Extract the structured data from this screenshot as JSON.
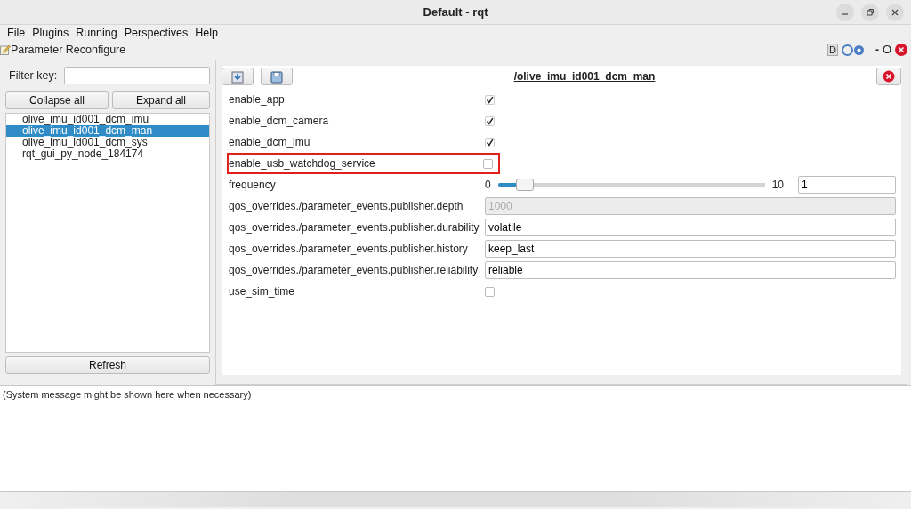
{
  "window": {
    "title": "Default - rqt"
  },
  "menu": [
    {
      "label": "File"
    },
    {
      "label": "Plugins"
    },
    {
      "label": "Running"
    },
    {
      "label": "Perspectives"
    },
    {
      "label": "Help"
    }
  ],
  "dock": {
    "title": "Parameter Reconfigure",
    "tools": [
      "D",
      "-",
      "O"
    ]
  },
  "filter": {
    "label": "Filter key:"
  },
  "tree_buttons": [
    "Collapse all",
    "Expand all"
  ],
  "nodes": [
    {
      "label": "olive_imu_id001_dcm_imu",
      "selected": false
    },
    {
      "label": "olive_imu_id001_dcm_man",
      "selected": true
    },
    {
      "label": "olive_imu_id001_dcm_sys",
      "selected": false
    },
    {
      "label": "rqt_gui_py_node_184174",
      "selected": false
    }
  ],
  "refresh_button": "Refresh",
  "node_title": "/olive_imu_id001_dcm_man",
  "params": [
    {
      "name": "enable_app",
      "kind": "checkbox",
      "checked": true,
      "highlighted": false
    },
    {
      "name": "enable_dcm_camera",
      "kind": "checkbox",
      "checked": true,
      "highlighted": false
    },
    {
      "name": "enable_dcm_imu",
      "kind": "checkbox",
      "checked": true,
      "highlighted": false
    },
    {
      "name": "enable_usb_watchdog_service",
      "kind": "checkbox",
      "checked": false,
      "highlighted": true
    },
    {
      "name": "frequency",
      "kind": "slider",
      "min": "0",
      "max": "10",
      "level": 0.1,
      "value": "1",
      "highlighted": false
    },
    {
      "name": "qos_overrides./parameter_events.publisher.depth",
      "kind": "text",
      "value": "1000",
      "disabled": true,
      "highlighted": false
    },
    {
      "name": "qos_overrides./parameter_events.publisher.durability",
      "kind": "text",
      "value": "volatile",
      "disabled": false,
      "highlighted": false
    },
    {
      "name": "qos_overrides./parameter_events.publisher.history",
      "kind": "text",
      "value": "keep_last",
      "disabled": false,
      "highlighted": false
    },
    {
      "name": "qos_overrides./parameter_events.publisher.reliability",
      "kind": "text",
      "value": "reliable",
      "disabled": false,
      "highlighted": false
    },
    {
      "name": "use_sim_time",
      "kind": "checkbox",
      "checked": false,
      "highlighted": false
    }
  ],
  "status_message": "(System message might be shown here when necessary)"
}
